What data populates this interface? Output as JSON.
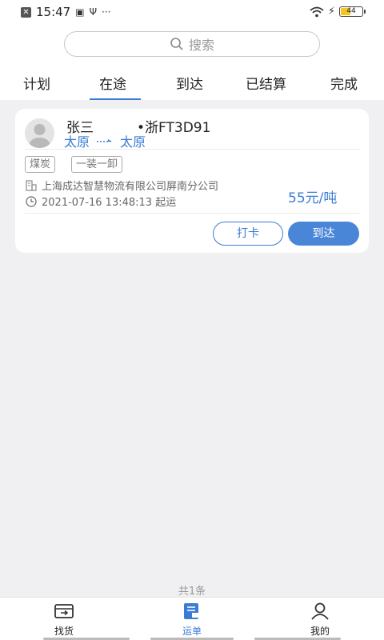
{
  "status_bar": {
    "time": "15:47",
    "battery": "44"
  },
  "search": {
    "placeholder": "搜索"
  },
  "tabs": [
    {
      "label": "计划"
    },
    {
      "label": "在途"
    },
    {
      "label": "到达"
    },
    {
      "label": "已结算"
    },
    {
      "label": "完成"
    }
  ],
  "order": {
    "driver_name": "张三",
    "plate": "•浙FT3D91",
    "origin": "太原",
    "destination": "太原",
    "tags": [
      "煤炭",
      "一装一卸"
    ],
    "company": "上海成达智慧物流有限公司屏南分公司",
    "start_time": "2021-07-16 13:48:13 起运",
    "price": "55元/吨",
    "clock_in_label": "打卡",
    "arrive_label": "到达"
  },
  "total_text": "共1条",
  "bottom_nav": [
    {
      "label": "找货"
    },
    {
      "label": "运单"
    },
    {
      "label": "我的"
    }
  ],
  "colors": {
    "accent": "#3a7bd5",
    "background": "#f0f0f2"
  }
}
